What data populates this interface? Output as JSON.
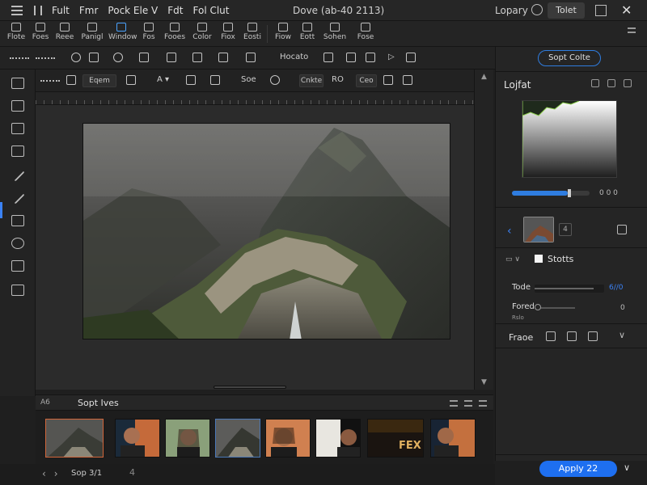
{
  "menubar": {
    "items": [
      "Fult",
      "Fmr",
      "Pock Ele V",
      "Fdt",
      "Fol Clut"
    ],
    "document_title": "Dove (ab-40 2113)",
    "library_label": "Lopary",
    "select_button": "Tolet"
  },
  "ribbon": {
    "tools": [
      "Flote",
      "Foes",
      "Reee",
      "Panigl",
      "Window",
      "Fos",
      "Fooes",
      "Color",
      "Fiox",
      "Eosti",
      "Fiow",
      "Eott",
      "Sohen",
      "Fose"
    ],
    "active_tool": "Window"
  },
  "toolbar1": {
    "preset_label": "Hocato"
  },
  "toolbar2": {
    "field_value": "Eqem",
    "size_label": "Soe",
    "color_label": "Cnkte",
    "color_value": "RO",
    "count_label": "Ceo"
  },
  "right_panel": {
    "top_pill": "Sopt Colte",
    "section_title": "Lojfat",
    "slider_value": "0 0 0",
    "slider_percent": 72,
    "layer_label": "Stotts",
    "tone_label": "Tode",
    "tone_value": "6//0",
    "tone_percent": 85,
    "fixed_label": "Fored",
    "fixed_sublabel": "Rslo",
    "fixed_value": "0",
    "frame_label": "Fraoe",
    "apply_button": "Apply 22"
  },
  "filmstrip": {
    "header_left": "A6",
    "title": "Sopt Ives",
    "thumbs": [
      {
        "id": "mountain-1",
        "state": "selected"
      },
      {
        "id": "portrait-1",
        "state": "normal"
      },
      {
        "id": "portrait-2",
        "state": "normal"
      },
      {
        "id": "mountain-2",
        "state": "active"
      },
      {
        "id": "portrait-3",
        "state": "normal"
      },
      {
        "id": "portrait-4",
        "state": "normal"
      },
      {
        "id": "poster",
        "state": "normal",
        "text": "FEX"
      },
      {
        "id": "portrait-5",
        "state": "normal"
      }
    ]
  },
  "statusbar": {
    "text": "Sop 3/1",
    "page": "4"
  },
  "colors": {
    "accent": "#1e6ff0",
    "selected_thumb_border": "#d0653a",
    "background": "#1f1f1f"
  }
}
